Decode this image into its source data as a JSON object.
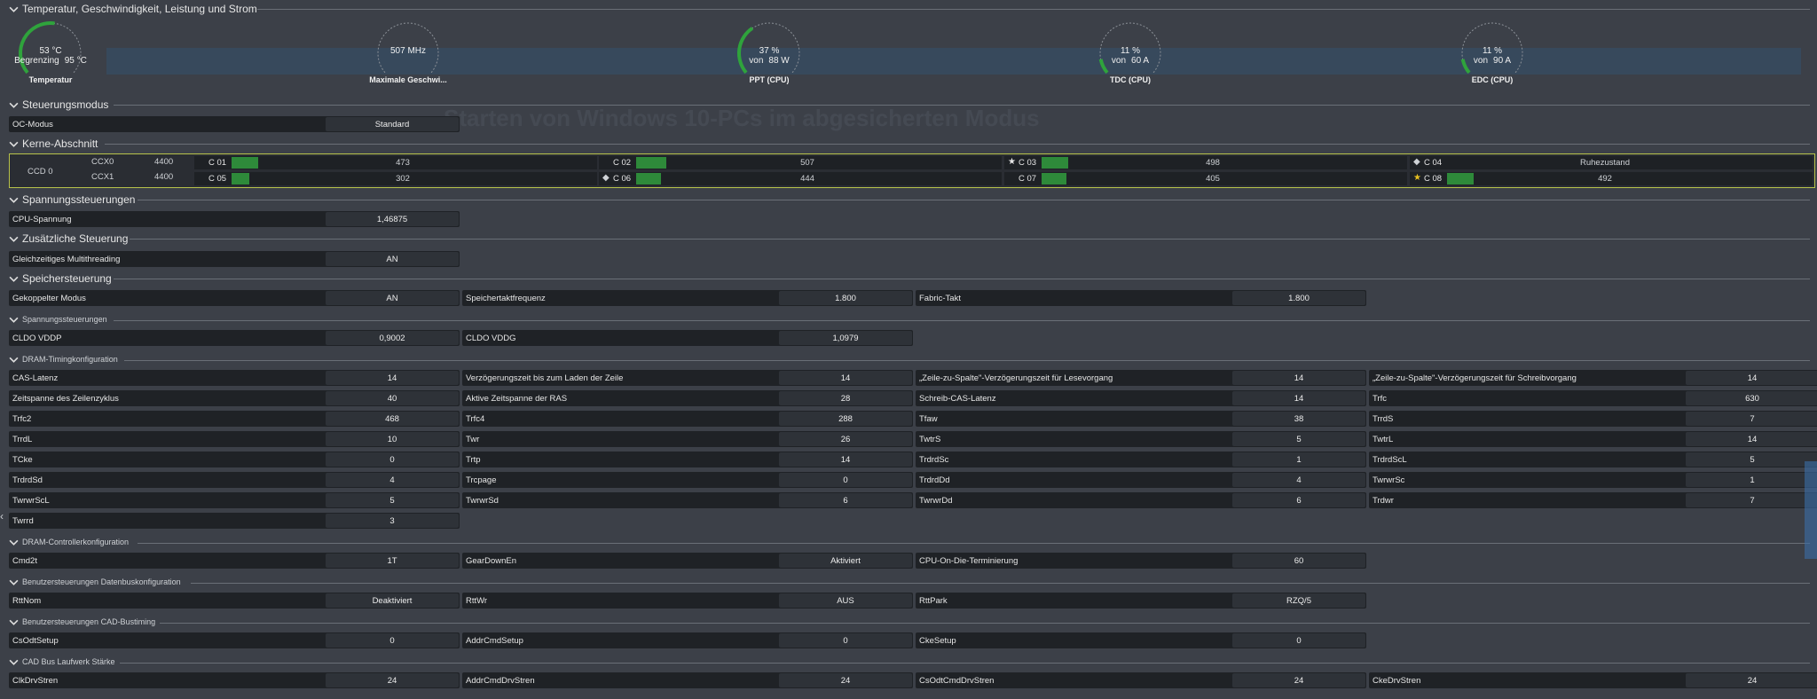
{
  "sections": {
    "s1": "Temperatur, Geschwindigkeit, Leistung und Strom",
    "s2": "Steuerungsmodus",
    "s3": "Kerne-Abschnitt",
    "s4": "Spannungssteuerungen",
    "s5": "Zusätzliche Steuerung",
    "s6": "Speichersteuerung",
    "s7": "Spannungssteuerungen",
    "s8": "DRAM-Timingkonfiguration",
    "s9": "DRAM-Controllerkonfiguration",
    "s10": "Benutzersteuerungen Datenbuskonfiguration",
    "s11": "Benutzersteuerungen CAD-Bustiming",
    "s12": "CAD Bus Laufwerk Stärke"
  },
  "background_title": "Starten von Windows 10-PCs im abgesicherten Modus",
  "gauges": [
    {
      "v1": "53 °C",
      "v2pre": "Begrenzing",
      "v2": "95 °C",
      "label": "Temperatur",
      "fraction": 0.53
    },
    {
      "v1": "507  MHz",
      "v2pre": "",
      "v2": "",
      "label": "Maximale Geschwi...",
      "fraction": 0.0
    },
    {
      "v1": "37 %",
      "v2pre": "von",
      "v2": "88 W",
      "label": "PPT (CPU)",
      "fraction": 0.37
    },
    {
      "v1": "11 %",
      "v2pre": "von",
      "v2": "60 A",
      "label": "TDC (CPU)",
      "fraction": 0.11
    },
    {
      "v1": "11 %",
      "v2pre": "von",
      "v2": "90 A",
      "label": "EDC (CPU)",
      "fraction": 0.11
    }
  ],
  "oc_mode": {
    "label": "OC-Modus",
    "value": "Standard"
  },
  "cores": {
    "ccd": "CCD 0",
    "ccx0": "CCX0",
    "ccx1": "CCX1",
    "ccx0_freq": "4400",
    "ccx1_freq": "4400",
    "list": [
      {
        "name": "C 01",
        "value": "473",
        "marker": ""
      },
      {
        "name": "C 02",
        "value": "507",
        "marker": ""
      },
      {
        "name": "C 03",
        "value": "498",
        "marker": "★"
      },
      {
        "name": "C 04",
        "value": "Ruhezustand",
        "marker": "◆"
      },
      {
        "name": "C 05",
        "value": "302",
        "marker": ""
      },
      {
        "name": "C 06",
        "value": "444",
        "marker": "◆"
      },
      {
        "name": "C 07",
        "value": "405",
        "marker": ""
      },
      {
        "name": "C 08",
        "value": "492",
        "marker": "★"
      }
    ]
  },
  "cpu_voltage": {
    "label": "CPU-Spannung",
    "value": "1,46875"
  },
  "smt": {
    "label": "Gleichzeitiges Multithreading",
    "value": "AN"
  },
  "memory": {
    "row1": [
      {
        "label": "Gekoppelter Modus",
        "value": "AN"
      },
      {
        "label": "Speichertaktfrequenz",
        "value": "1.800"
      },
      {
        "label": "Fabric-Takt",
        "value": "1.800"
      }
    ],
    "row2": [
      {
        "label": "CLDO VDDP",
        "value": "0,9002"
      },
      {
        "label": "CLDO VDDG",
        "value": "1,0979"
      }
    ]
  },
  "timings": [
    [
      {
        "label": "CAS-Latenz",
        "value": "14"
      },
      {
        "label": "Verzögerungszeit bis zum Laden der Zeile",
        "value": "14"
      },
      {
        "label": "„Zeile-zu-Spalte\"-Verzögerungszeit für Lesevorgang",
        "value": "14"
      },
      {
        "label": "„Zeile-zu-Spalte\"-Verzögerungszeit für Schreibvorgang",
        "value": "14"
      }
    ],
    [
      {
        "label": "Zeitspanne des Zeilenzyklus",
        "value": "40"
      },
      {
        "label": "Aktive Zeitspanne der RAS",
        "value": "28"
      },
      {
        "label": "Schreib-CAS-Latenz",
        "value": "14"
      },
      {
        "label": "Trfc",
        "value": "630"
      }
    ],
    [
      {
        "label": "Trfc2",
        "value": "468"
      },
      {
        "label": "Trfc4",
        "value": "288"
      },
      {
        "label": "Tfaw",
        "value": "38"
      },
      {
        "label": "TrrdS",
        "value": "7"
      }
    ],
    [
      {
        "label": "TrrdL",
        "value": "10"
      },
      {
        "label": "Twr",
        "value": "26"
      },
      {
        "label": "TwtrS",
        "value": "5"
      },
      {
        "label": "TwtrL",
        "value": "14"
      }
    ],
    [
      {
        "label": "TCke",
        "value": "0"
      },
      {
        "label": "Trtp",
        "value": "14"
      },
      {
        "label": "TrdrdSc",
        "value": "1"
      },
      {
        "label": "TrdrdScL",
        "value": "5"
      }
    ],
    [
      {
        "label": "TrdrdSd",
        "value": "4"
      },
      {
        "label": "Trcpage",
        "value": "0"
      },
      {
        "label": "TrdrdDd",
        "value": "4"
      },
      {
        "label": "TwrwrSc",
        "value": "1"
      }
    ],
    [
      {
        "label": "TwrwrScL",
        "value": "5"
      },
      {
        "label": "TwrwrSd",
        "value": "6"
      },
      {
        "label": "TwrwrDd",
        "value": "6"
      },
      {
        "label": "Trdwr",
        "value": "7"
      }
    ],
    [
      {
        "label": "Twrrd",
        "value": "3"
      }
    ]
  ],
  "controller": [
    {
      "label": "Cmd2t",
      "value": "1T"
    },
    {
      "label": "GearDownEn",
      "value": "Aktiviert"
    },
    {
      "label": "CPU-On-Die-Terminierung",
      "value": "60"
    }
  ],
  "databus": [
    {
      "label": "RttNom",
      "value": "Deaktiviert"
    },
    {
      "label": "RttWr",
      "value": "AUS"
    },
    {
      "label": "RttPark",
      "value": "RZQ/5"
    }
  ],
  "cadtiming": [
    {
      "label": "CsOdtSetup",
      "value": "0"
    },
    {
      "label": "AddrCmdSetup",
      "value": "0"
    },
    {
      "label": "CkeSetup",
      "value": "0"
    }
  ],
  "cadstrength": [
    {
      "label": "ClkDrvStren",
      "value": "24"
    },
    {
      "label": "AddrCmdDrvStren",
      "value": "24"
    },
    {
      "label": "CsOdtCmdDrvStren",
      "value": "24"
    },
    {
      "label": "CkeDrvStren",
      "value": "24"
    }
  ],
  "colors": {
    "gauge_arc": "#2fa33c",
    "gauge_track": "#8a8f96",
    "core_bar": "#2e8a3a",
    "cores_border": "#b8c24a"
  }
}
